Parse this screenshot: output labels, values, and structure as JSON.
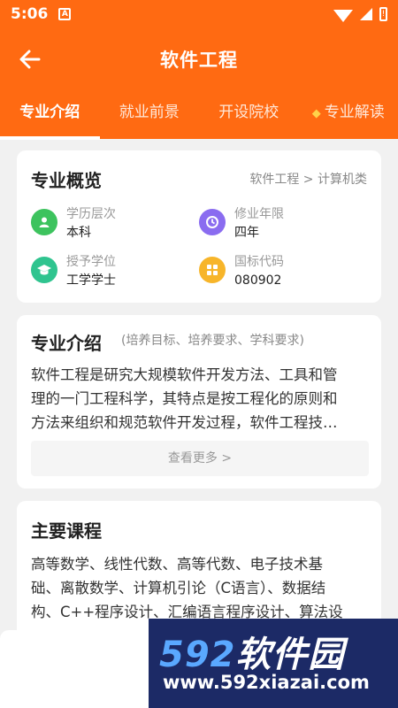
{
  "status_bar": {
    "time": "5:06",
    "notif_icon": "A",
    "battery_label": "!"
  },
  "titlebar": {
    "title": "软件工程"
  },
  "tabs": [
    {
      "label": "专业介绍",
      "active": true
    },
    {
      "label": "就业前景",
      "active": false
    },
    {
      "label": "开设院校",
      "active": false
    },
    {
      "label": "专业解读",
      "active": false,
      "icon": "gem-icon"
    }
  ],
  "overview": {
    "title": "专业概览",
    "breadcrumb": "软件工程 > 计算机类",
    "items": [
      {
        "label": "学历层次",
        "value": "本科",
        "icon": "user-icon",
        "color": "#3dc35e"
      },
      {
        "label": "修业年限",
        "value": "四年",
        "icon": "clock-icon",
        "color": "#8a6cf0"
      },
      {
        "label": "授予学位",
        "value": "工学学士",
        "icon": "graduation-cap-icon",
        "color": "#2fc48f"
      },
      {
        "label": "国标代码",
        "value": "080902",
        "icon": "grid-icon",
        "color": "#f7b52a"
      }
    ]
  },
  "intro": {
    "title": "专业介绍",
    "subtitle": "(培养目标、培养要求、学科要求)",
    "lines": [
      "软件工程是研究大规模软件开发方法、工具和管",
      "理的一门工程科学，其特点是按工程化的原则和",
      "方法来组织和规范软件开发过程，软件工程技…"
    ],
    "more_label": "查看更多 >"
  },
  "courses": {
    "title": "主要课程",
    "lines": [
      "高等数学、线性代数、高等代数、电子技术基",
      "础、离散数学、计算机引论（C语言）、数据结",
      "构、C++程序设计、汇编语言程序设计、算法设"
    ]
  },
  "watermark": {
    "num": "592",
    "brand": "软件园",
    "url": "www.592xiazai.com"
  },
  "colors": {
    "primary": "#ff6a12",
    "background": "#f1f1f1",
    "card": "#ffffff"
  }
}
